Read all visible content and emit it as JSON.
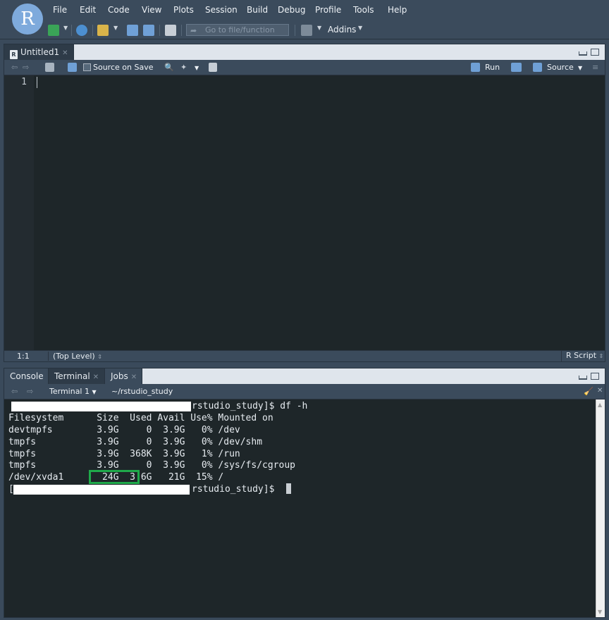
{
  "app": {
    "logo_letter": "R"
  },
  "menu": [
    "File",
    "Edit",
    "Code",
    "View",
    "Plots",
    "Session",
    "Build",
    "Debug",
    "Profile",
    "Tools",
    "Help"
  ],
  "toolbar": {
    "goto_placeholder": "Go to file/function",
    "addins_label": "Addins"
  },
  "editor": {
    "tab_title": "Untitled1",
    "source_on_save": "Source on Save",
    "run_label": "Run",
    "source_label": "Source",
    "line_number": "1",
    "status_position": "1:1",
    "status_scope": "(Top Level)",
    "status_filetype": "R Script"
  },
  "console": {
    "tabs": [
      "Console",
      "Terminal",
      "Jobs"
    ],
    "active_tab": "Terminal",
    "terminal_selector": "Terminal 1",
    "working_dir": "~/rstudio_study",
    "lines": [
      "rstudio_study]$ df -h",
      "Filesystem      Size  Used Avail Use% Mounted on",
      "devtmpfs        3.9G     0  3.9G   0% /dev",
      "tmpfs           3.9G     0  3.9G   0% /dev/shm",
      "tmpfs           3.9G  368K  3.9G   1% /run",
      "tmpfs           3.9G     0  3.9G   0% /sys/fs/cgroup",
      "/dev/xvda1       24G  3.6G   21G  15% /",
      "rstudio_study]$"
    ],
    "highlight_color": "#1fa94a"
  },
  "colors": {
    "chrome": "#3b4b5c",
    "editor_bg": "#1e2629",
    "tabbar_bg": "#dfe5ec"
  }
}
